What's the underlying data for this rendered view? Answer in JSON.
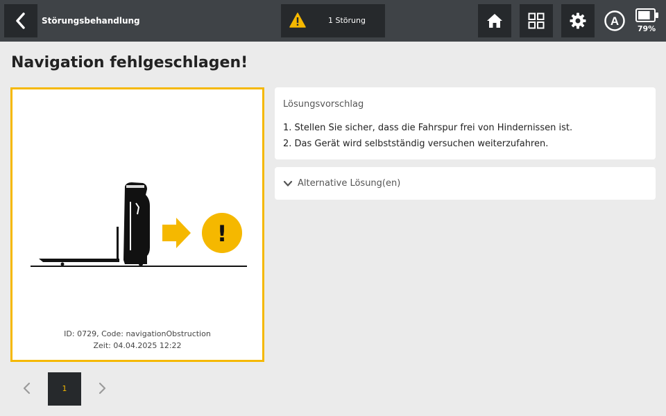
{
  "header": {
    "title": "Störungsbehandlung",
    "fault_summary": "1 Störung",
    "battery_percent": "79%",
    "battery_level": 0.79,
    "mode_letter": "A",
    "icons": [
      "back-arrow-icon",
      "warning-icon",
      "home-icon",
      "grid-icon",
      "gear-icon",
      "auto-mode-icon",
      "battery-icon"
    ]
  },
  "page": {
    "title": "Navigation fehlgeschlagen!"
  },
  "error_card": {
    "id_line": "ID: 0729, Code: navigationObstruction",
    "time_line": "Zeit: 04.04.2025 12:22",
    "illustration_symbol": "!"
  },
  "solution": {
    "heading": "Lösungsvorschlag",
    "steps": [
      "1. Stellen Sie sicher, dass die Fahrspur frei von Hindernissen ist.",
      "2. Das Gerät wird selbstständig versuchen weiterzufahren."
    ]
  },
  "alternative": {
    "label": "Alternative Lösung(en)"
  },
  "pagination": {
    "current_page": "1"
  },
  "colors": {
    "accent": "#f5b800",
    "topbar": "#3f4347",
    "button_dark": "#26292c",
    "background": "#ebebeb"
  }
}
